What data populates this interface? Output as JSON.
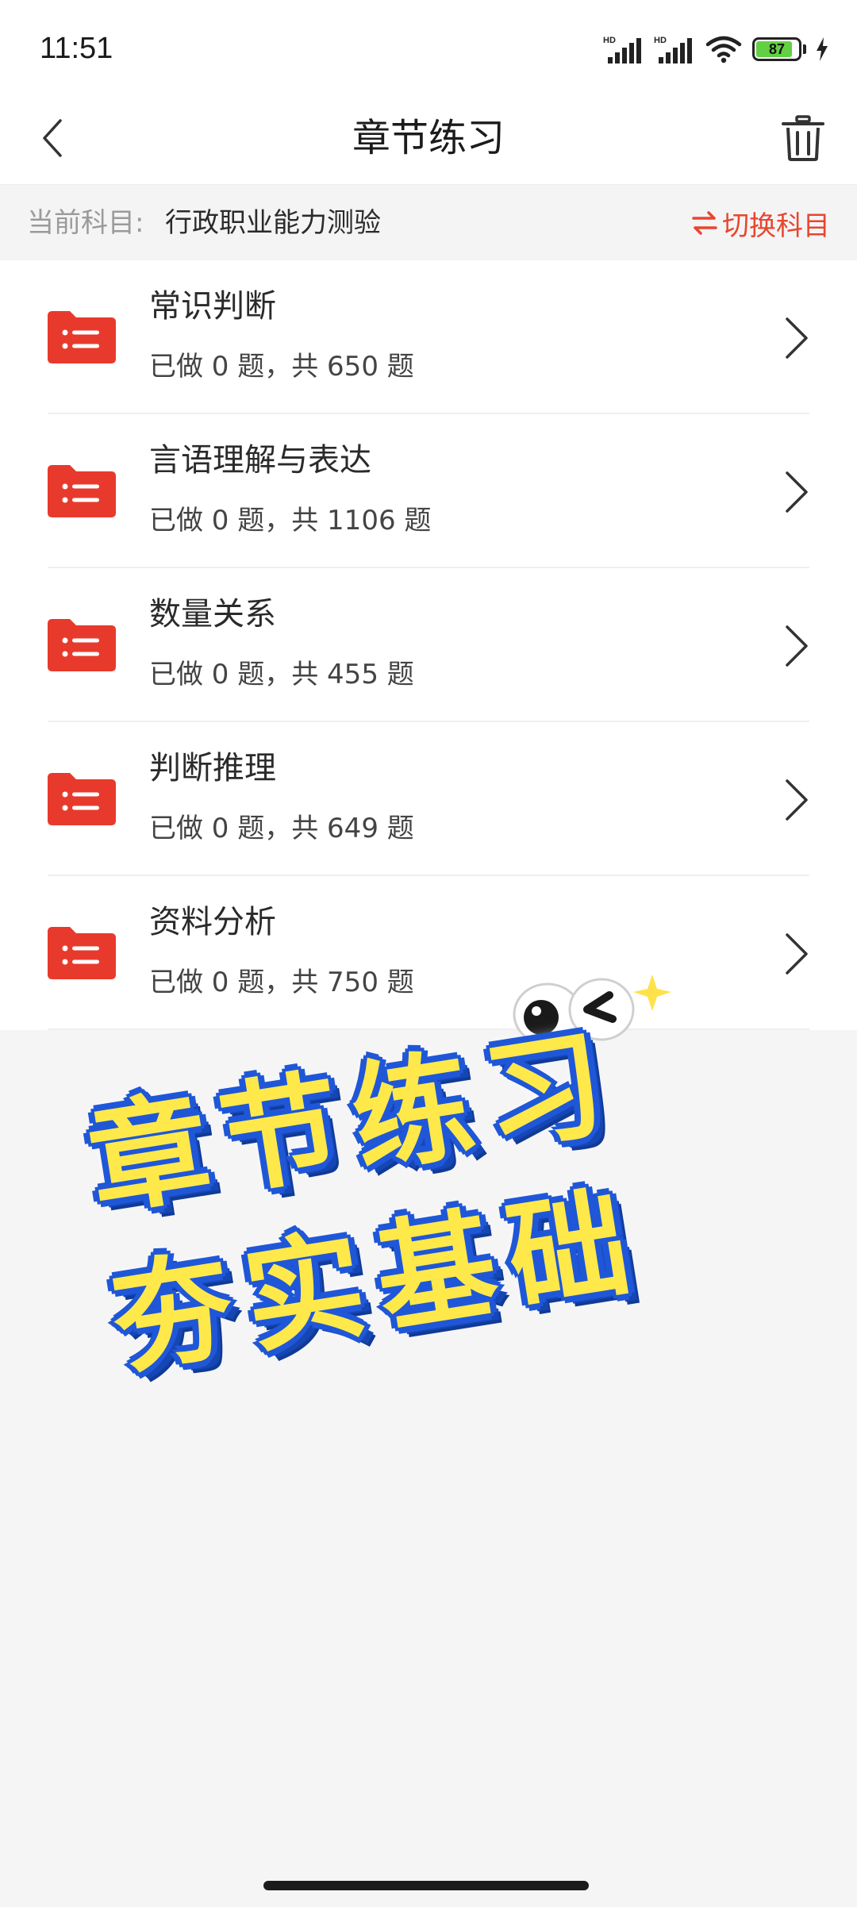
{
  "status_bar": {
    "time": "11:51",
    "network_1": "HD",
    "network_2": "HD",
    "battery_level": "87",
    "battery_percent": 87
  },
  "nav": {
    "title": "章节练习",
    "back_icon": "chevron-left-icon",
    "delete_icon": "trash-icon"
  },
  "subject": {
    "label": "当前科目:",
    "value": "行政职业能力测验",
    "switch_label": "切换科目",
    "switch_icon": "swap-arrows-icon"
  },
  "chapters": [
    {
      "name": "常识判断",
      "progress": "已做 0 题，共 650 题"
    },
    {
      "name": "言语理解与表达",
      "progress": "已做 0 题，共 1106 题"
    },
    {
      "name": "数量关系",
      "progress": "已做 0 题，共 455 题"
    },
    {
      "name": "判断推理",
      "progress": "已做 0 题，共 649 题"
    },
    {
      "name": "资料分析",
      "progress": "已做 0 题，共 750 题"
    }
  ],
  "promo": {
    "line1": "章节练习",
    "line2": "夯实基础"
  },
  "colors": {
    "accent": "#e8462f",
    "folder": "#e83a2c",
    "battery": "#62d043",
    "promo_fill": "#ffe94a",
    "promo_outline": "#1f57d8"
  }
}
